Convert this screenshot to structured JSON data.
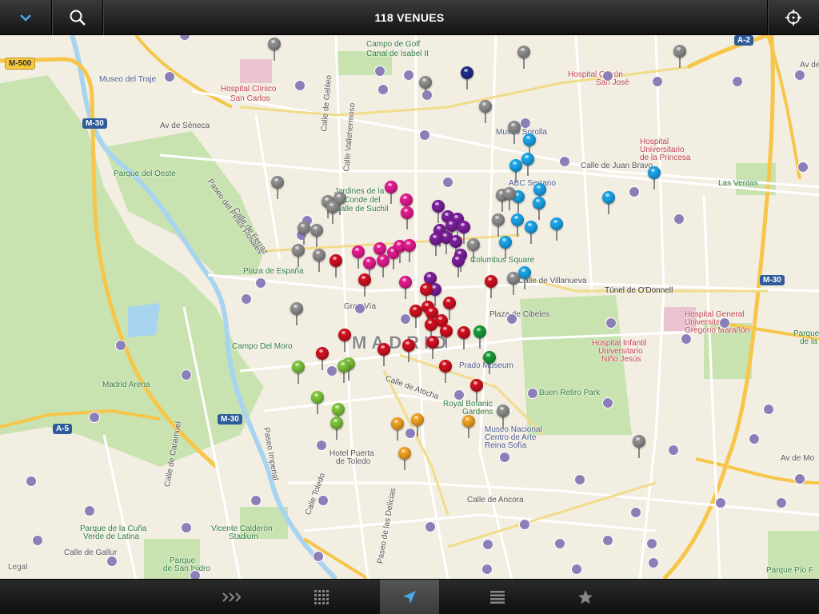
{
  "header": {
    "title": "118 VENUES"
  },
  "map": {
    "labels": [
      {
        "text": "M-500",
        "type": "shield-yellow"
      },
      {
        "text": "M-30",
        "type": "shield-blue"
      },
      {
        "text": "M-30",
        "type": "shield-blue"
      },
      {
        "text": "A-2",
        "type": "shield-blue"
      },
      {
        "text": "M-30",
        "type": "shield-blue"
      },
      {
        "text": "A-5",
        "type": "shield-blue"
      },
      {
        "text": "Museo del Traje"
      },
      {
        "text": "Hospital Clínico"
      },
      {
        "text": "San Carlos"
      },
      {
        "text": "Campo de Golf"
      },
      {
        "text": "Canal de Isabel II"
      },
      {
        "text": "Hospital Quirón"
      },
      {
        "text": "San José"
      },
      {
        "text": "Av de Séneca"
      },
      {
        "text": "Calle de Galileo"
      },
      {
        "text": "Calle Vallehermoso"
      },
      {
        "text": "Museo Sorolla"
      },
      {
        "text": "Hospital"
      },
      {
        "text": "Universitario"
      },
      {
        "text": "de la Princesa"
      },
      {
        "text": "Parque del Oeste"
      },
      {
        "text": "Jardines de la"
      },
      {
        "text": "Conde del"
      },
      {
        "text": "Valle de Suchil"
      },
      {
        "text": "Calle de Juan Bravo"
      },
      {
        "text": "ABC Serrano"
      },
      {
        "text": "Las Ventas"
      },
      {
        "text": "Paseo del Pintor Rosales"
      },
      {
        "text": "Calle de Ferraz"
      },
      {
        "text": "Columbus Square"
      },
      {
        "text": "Calle de Villanueva"
      },
      {
        "text": "Plaza de España"
      },
      {
        "text": "Túnel de O'Donnell"
      },
      {
        "text": "Gran Vía"
      },
      {
        "text": "Plaza de Cibeles"
      },
      {
        "text": "Hospital General"
      },
      {
        "text": "Universitario"
      },
      {
        "text": "Gregorio Marañón"
      },
      {
        "text": "MADRID"
      },
      {
        "text": "Campo Del Moro"
      },
      {
        "text": "Hospital Infantil"
      },
      {
        "text": "Universitario"
      },
      {
        "text": "Niño Jesús"
      },
      {
        "text": "Prado Museum"
      },
      {
        "text": "Madrid Arena"
      },
      {
        "text": "Calle de Atocha"
      },
      {
        "text": "Buen Retiro Park"
      },
      {
        "text": "Royal Botanic"
      },
      {
        "text": "Gardens"
      },
      {
        "text": "Museo Nacional"
      },
      {
        "text": "Centro de Arte"
      },
      {
        "text": "Reina Sofía"
      },
      {
        "text": "Paseo Imperial"
      },
      {
        "text": "Hotel Puerta"
      },
      {
        "text": "de Toledo"
      },
      {
        "text": "Calle de Caramuel"
      },
      {
        "text": "Calle Toledo"
      },
      {
        "text": "Calle de Ancora"
      },
      {
        "text": "Av de Mo"
      },
      {
        "text": "Parque de la Cuña"
      },
      {
        "text": "Verde de Latina"
      },
      {
        "text": "Vicente Calderón"
      },
      {
        "text": "Stadium"
      },
      {
        "text": "Calle de Gallur"
      },
      {
        "text": "Parque"
      },
      {
        "text": "de San Isidro"
      },
      {
        "text": "Paseo de las Delicias"
      },
      {
        "text": "Parque Pío F"
      },
      {
        "text": "Av de"
      },
      {
        "text": "Parque"
      },
      {
        "text": "de la"
      },
      {
        "text": "Legal"
      }
    ],
    "pin_colors": {
      "gray": "#8e8e8e",
      "navy": "#1f2d8a",
      "blue": "#1aa3e8",
      "magenta": "#e21a8e",
      "purple": "#7a1f9a",
      "red": "#cf1020",
      "green_light": "#7cc23a",
      "green_dark": "#1a9a3a",
      "orange": "#f0a020"
    }
  },
  "tabbar": {
    "tabs": [
      {
        "name": "tab-featured",
        "icon": "chevrons-icon"
      },
      {
        "name": "tab-grid",
        "icon": "grid-icon"
      },
      {
        "name": "tab-map",
        "icon": "location-arrow-icon",
        "active": true
      },
      {
        "name": "tab-list",
        "icon": "list-icon"
      },
      {
        "name": "tab-favorites",
        "icon": "star-icon"
      }
    ]
  },
  "colors": {
    "accent": "#4aa8e8",
    "park": "#c9e3b0",
    "water": "#a8d4ef",
    "highway": "#f6c64a"
  }
}
